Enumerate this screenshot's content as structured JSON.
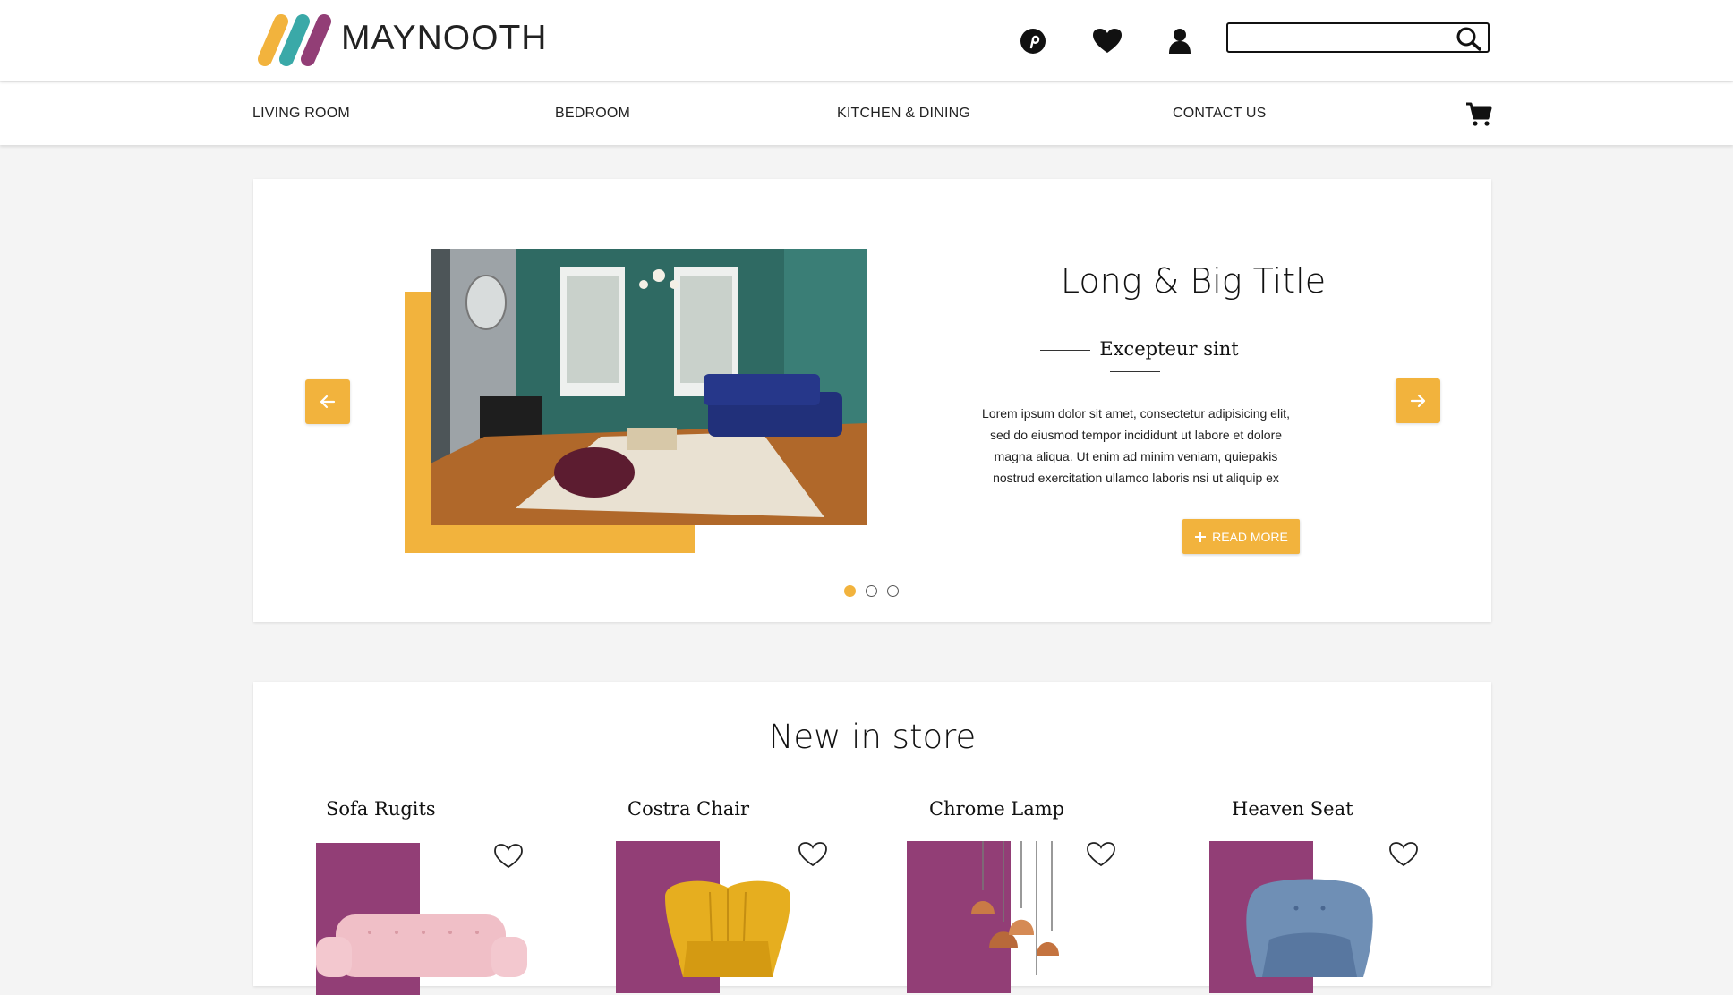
{
  "header": {
    "brand_name": "MAYNOOTH",
    "icons": [
      "pinterest-icon",
      "heart-icon",
      "user-icon",
      "search-icon"
    ],
    "search_placeholder": ""
  },
  "nav": {
    "items": [
      {
        "label": "LIVING ROOM"
      },
      {
        "label": "BEDROOM"
      },
      {
        "label": "KITCHEN & DINING"
      },
      {
        "label": "CONTACT US"
      }
    ],
    "cart_icon": "cart-icon"
  },
  "hero": {
    "title": "Long & Big Title",
    "subtitle": "Excepteur sint",
    "body": "Lorem ipsum dolor sit amet, consectetur adipisicing elit, sed do eiusmod tempor incididunt ut labore et dolore magna aliqua. Ut enim ad minim veniam, quiepakis nostrud exercitation ullamco laboris nsi ut aliquip ex",
    "button_label": "READ MORE",
    "slides": 3,
    "active_slide": 1
  },
  "store": {
    "title": "New in store",
    "products": [
      {
        "name": "Sofa Rugits"
      },
      {
        "name": "Costra Chair"
      },
      {
        "name": "Chrome Lamp"
      },
      {
        "name": "Heaven Seat"
      }
    ]
  },
  "colors": {
    "accent": "#f2b33d",
    "plum": "#923e76",
    "teal": "#3aa9a8",
    "background": "#f4f4f4"
  }
}
